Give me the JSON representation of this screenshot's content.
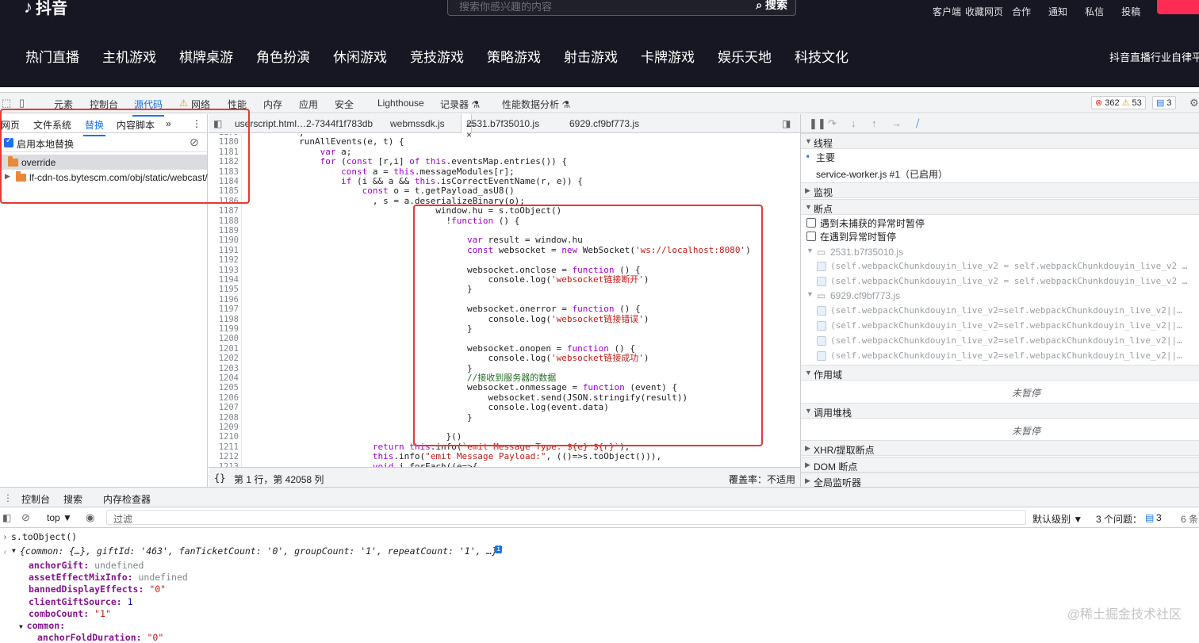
{
  "site": {
    "logo": "抖音",
    "search_placeholder": "搜索你感兴趣的内容",
    "search_button": "搜索",
    "top_links": [
      "客户端",
      "收藏网页",
      "合作",
      "通知",
      "私信",
      "投稿"
    ],
    "nav": [
      "热门直播",
      "主机游戏",
      "棋牌桌游",
      "角色扮演",
      "休闲游戏",
      "竞技游戏",
      "策略游戏",
      "射击游戏",
      "卡牌游戏",
      "娱乐天地",
      "科技文化"
    ],
    "right_text": "抖音直播行业自律平"
  },
  "devtools": {
    "tabs": [
      "元素",
      "控制台",
      "源代码",
      "网络",
      "性能",
      "内存",
      "应用",
      "安全",
      "Lighthouse",
      "记录器 ⚗",
      "性能数据分析 ⚗"
    ],
    "active_tab": "源代码",
    "errors": "362",
    "warnings": "53",
    "infos": "3"
  },
  "navigator": {
    "tabs": [
      "网页",
      "文件系统",
      "替换",
      "内容脚本",
      "»"
    ],
    "active": "替换",
    "enable_label": "启用本地替换",
    "tree": [
      "override",
      "lf-cdn-tos.bytescm.com/obj/static/webcast/"
    ]
  },
  "editor": {
    "tabs": [
      "userscript.html…2-7344f1f783db",
      "webmssdk.js",
      "2531.b7f35010.js ×",
      "6929.cf9bf773.js"
    ],
    "status_left": "第 1 行，第 42058 列",
    "status_right": "覆盖率：不适用",
    "line_numbers": [
      "1179",
      "1180",
      "1181",
      "1182",
      "1183",
      "1184",
      "1185",
      "1186",
      "1187",
      "1188",
      "1189",
      "1190",
      "1191",
      "1192",
      "1193",
      "1194",
      "1195",
      "1196",
      "1197",
      "1198",
      "1199",
      "1200",
      "1201",
      "1202",
      "1203",
      "1204",
      "1205",
      "1206",
      "1207",
      "1208",
      "1209",
      "1210",
      "1211",
      "1212",
      "1213"
    ],
    "code": [
      {
        "indent": 10,
        "text": "}"
      },
      {
        "indent": 10,
        "text": "runAllEvents(e, t) {"
      },
      {
        "indent": 14,
        "text": "var a;"
      },
      {
        "indent": 14,
        "text": "for (const [r,i] of this.eventsMap.entries()) {"
      },
      {
        "indent": 18,
        "text": "const a = this.messageModules[r];"
      },
      {
        "indent": 18,
        "text": "if (i && a && this.isCorrectEventName(r, e)) {"
      },
      {
        "indent": 22,
        "text": "const o = t.getPayload_asU8()"
      },
      {
        "indent": 24,
        "text": ", s = a.deserializeBinary(o);"
      },
      {
        "indent": 36,
        "text": "window.hu = s.toObject()"
      },
      {
        "indent": 38,
        "text": "!function () {"
      },
      {
        "indent": 0,
        "text": ""
      },
      {
        "indent": 42,
        "text": "var result = window.hu"
      },
      {
        "indent": 42,
        "text": "const websocket = new WebSocket('ws://localhost:8080')"
      },
      {
        "indent": 0,
        "text": ""
      },
      {
        "indent": 42,
        "text": "websocket.onclose = function () {"
      },
      {
        "indent": 46,
        "text": "console.log('websocket链接断开')"
      },
      {
        "indent": 42,
        "text": "}"
      },
      {
        "indent": 0,
        "text": ""
      },
      {
        "indent": 42,
        "text": "websocket.onerror = function () {"
      },
      {
        "indent": 46,
        "text": "console.log('websocket链接错误')"
      },
      {
        "indent": 42,
        "text": "}"
      },
      {
        "indent": 0,
        "text": ""
      },
      {
        "indent": 42,
        "text": "websocket.onopen = function () {"
      },
      {
        "indent": 46,
        "text": "console.log('websocket链接成功')"
      },
      {
        "indent": 42,
        "text": "}"
      },
      {
        "indent": 42,
        "text": "//接收到服务器的数据"
      },
      {
        "indent": 42,
        "text": "websocket.onmessage = function (event) {"
      },
      {
        "indent": 46,
        "text": "websocket.send(JSON.stringify(result))"
      },
      {
        "indent": 46,
        "text": "console.log(event.data)"
      },
      {
        "indent": 42,
        "text": "}"
      },
      {
        "indent": 0,
        "text": ""
      },
      {
        "indent": 38,
        "text": "}()"
      },
      {
        "indent": 24,
        "text": "return this.info(`emit Message Type: ${e} ${r}`),"
      },
      {
        "indent": 24,
        "text": "this.info(\"emit Message Payload:\", (()=>s.toObject())),"
      },
      {
        "indent": 24,
        "text": "void i.forEach((e=>{"
      }
    ]
  },
  "debugger": {
    "threads_title": "线程",
    "main_thread": "主要",
    "worker": "service-worker.js #1（已启用）",
    "watch": "监视",
    "breakpoints": "断点",
    "pause_uncaught": "遇到未捕获的异常时暂停",
    "pause_caught": "在遇到异常时暂停",
    "bp_files": [
      {
        "file": "2531.b7f35010.js",
        "lines": [
          "(self.webpackChunkdouyin_live_v2 = self.webpackChunkdouyin_live_v2 …",
          "(self.webpackChunkdouyin_live_v2 = self.webpackChunkdouyin_live_v2 …"
        ]
      },
      {
        "file": "6929.cf9bf773.js",
        "lines": [
          "(self.webpackChunkdouyin_live_v2=self.webpackChunkdouyin_live_v2||…",
          "(self.webpackChunkdouyin_live_v2=self.webpackChunkdouyin_live_v2||…",
          "(self.webpackChunkdouyin_live_v2=self.webpackChunkdouyin_live_v2||…",
          "(self.webpackChunkdouyin_live_v2=self.webpackChunkdouyin_live_v2||…"
        ]
      }
    ],
    "scope": "作用域",
    "not_paused": "未暂停",
    "callstack": "调用堆栈",
    "xhr": "XHR/提取断点",
    "dom": "DOM 断点",
    "global": "全局监听器"
  },
  "drawer": {
    "tabs": [
      "控制台",
      "搜索",
      "内存检查器"
    ],
    "context": "top ▼",
    "filter_placeholder": "过滤",
    "level": "默认级别 ▼",
    "issues": "3 个问题：",
    "issues_count": "3",
    "hidden": "6 条"
  },
  "console": {
    "input": "s.toObject()",
    "summary": "{common: {…}, giftId: '463', fanTicketCount: '0', groupCount: '1', repeatCount: '1', …}",
    "props": [
      {
        "key": "anchorGift",
        "value": "undefined",
        "type": "undef"
      },
      {
        "key": "assetEffectMixInfo",
        "value": "undefined",
        "type": "undef"
      },
      {
        "key": "bannedDisplayEffects",
        "value": "\"0\"",
        "type": "str"
      },
      {
        "key": "clientGiftSource",
        "value": "1",
        "type": "num"
      },
      {
        "key": "comboCount",
        "value": "\"1\"",
        "type": "str"
      },
      {
        "key": "common",
        "value": "",
        "type": "obj"
      },
      {
        "key": "anchorFoldDuration",
        "value": "\"0\"",
        "type": "str"
      }
    ]
  },
  "watermark": "@稀土掘金技术社区"
}
